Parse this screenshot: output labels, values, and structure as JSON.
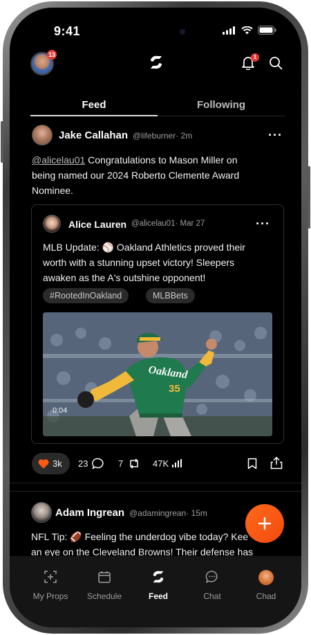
{
  "status_bar": {
    "time": "9:41"
  },
  "header": {
    "notification_count": "13",
    "bell_count": "1"
  },
  "tabs": [
    {
      "label": "Feed",
      "active": true
    },
    {
      "label": "Following",
      "active": false
    }
  ],
  "post1": {
    "author": "Jake Callahan",
    "handle": "@lifeburner",
    "time": "· 2m",
    "mention": "@alicelau01",
    "text_line1": " Congratulations to Mason Miller on",
    "text_line2": "being named our 2024 Roberto Clemente Award",
    "text_line3": "Nominee.",
    "quote": {
      "author": "Alice Lauren",
      "handle": "@alicelau01",
      "time": "· Mar 27",
      "text_line1": "MLB Update: ⚾ Oakland Athletics proved their",
      "text_line2": "worth with a stunning upset victory! Sleepers",
      "text_line3": "awaken as the A's outshine opponent!",
      "tags": [
        "#RootedInOakland",
        "MLBBets"
      ],
      "video_time": "0:04",
      "jersey_text": "Oakland",
      "jersey_number": "35"
    },
    "actions": {
      "likes": "3k",
      "comments": "23",
      "reposts": "7",
      "views": "47K"
    }
  },
  "post2": {
    "author": "Adam Ingrean",
    "handle": "@adamingrean",
    "time": "· 15m",
    "text_line1": "NFL Tip: 🏈  Feeling the underdog vibe today? Kee",
    "text_line2": "an eye on the Cleveland Browns! Their defense has"
  },
  "fab": {
    "symbol": "+"
  },
  "bottom_nav": [
    {
      "label": "My Props",
      "icon": "props-icon",
      "active": false
    },
    {
      "label": "Schedule",
      "icon": "calendar-icon",
      "active": false
    },
    {
      "label": "Feed",
      "icon": "feed-logo-icon",
      "active": true
    },
    {
      "label": "Chat",
      "icon": "chat-icon",
      "active": false
    },
    {
      "label": "Chad",
      "icon": "avatar",
      "active": false
    }
  ],
  "colors": {
    "accent": "#ff5a14",
    "background": "#000000",
    "like": "#ff5a14"
  }
}
